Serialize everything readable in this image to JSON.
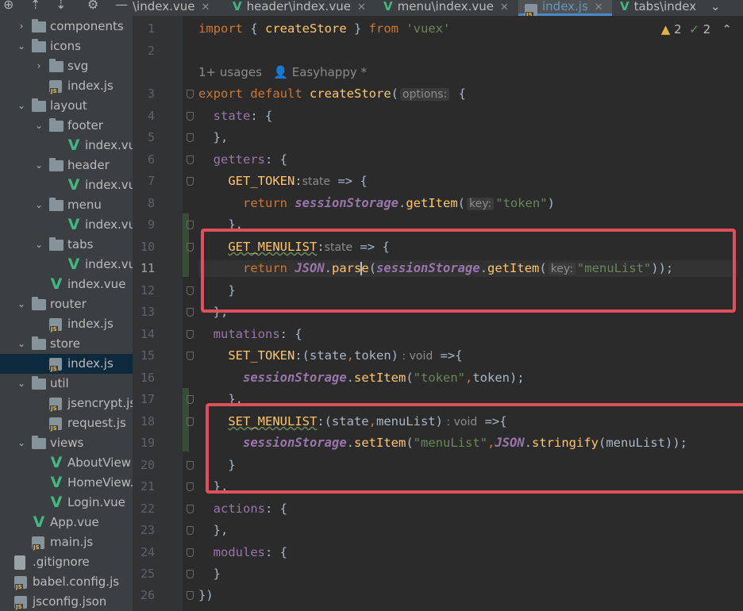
{
  "sidebar": {
    "items": [
      {
        "label": "components",
        "type": "folder",
        "open": false
      },
      {
        "label": "icons",
        "type": "folder",
        "open": true
      },
      {
        "label": "svg",
        "type": "folder",
        "open": false
      },
      {
        "label": "index.js",
        "type": "js"
      },
      {
        "label": "layout",
        "type": "folder",
        "open": true
      },
      {
        "label": "footer",
        "type": "folder",
        "open": true
      },
      {
        "label": "index.vu",
        "type": "vue"
      },
      {
        "label": "header",
        "type": "folder",
        "open": true
      },
      {
        "label": "index.vu",
        "type": "vue"
      },
      {
        "label": "menu",
        "type": "folder",
        "open": true
      },
      {
        "label": "index.vu",
        "type": "vue"
      },
      {
        "label": "tabs",
        "type": "folder",
        "open": true
      },
      {
        "label": "index.vu",
        "type": "vue"
      },
      {
        "label": "index.vue",
        "type": "vue"
      },
      {
        "label": "router",
        "type": "folder",
        "open": true
      },
      {
        "label": "index.js",
        "type": "js"
      },
      {
        "label": "store",
        "type": "folder",
        "open": true
      },
      {
        "label": "index.js",
        "type": "js",
        "selected": true
      },
      {
        "label": "util",
        "type": "folder",
        "open": true
      },
      {
        "label": "jsencrypt.js",
        "type": "js"
      },
      {
        "label": "request.js",
        "type": "js"
      },
      {
        "label": "views",
        "type": "folder",
        "open": true
      },
      {
        "label": "AboutView",
        "type": "vue"
      },
      {
        "label": "HomeView.",
        "type": "vue"
      },
      {
        "label": "Login.vue",
        "type": "vue"
      },
      {
        "label": "App.vue",
        "type": "vue"
      },
      {
        "label": "main.js",
        "type": "js"
      },
      {
        "label": ".gitignore",
        "type": "git"
      },
      {
        "label": "babel.config.js",
        "type": "js"
      },
      {
        "label": "jsconfig.json",
        "type": "json"
      }
    ]
  },
  "tabs": [
    {
      "label": "\\index.vue",
      "active": false
    },
    {
      "label": "header\\index.vue",
      "active": false
    },
    {
      "label": "menu\\index.vue",
      "active": false
    },
    {
      "label": "index.js",
      "active": true
    },
    {
      "label": "tabs\\index",
      "active": false
    }
  ],
  "status": {
    "warnings": "2",
    "typos": "2"
  },
  "meta": {
    "usages": "1+ usages",
    "author": "Easyhappy *"
  },
  "line_numbers": [
    "1",
    "2",
    "3",
    "4",
    "5",
    "6",
    "7",
    "8",
    "9",
    "10",
    "11",
    "12",
    "13",
    "14",
    "15",
    "16",
    "17",
    "18",
    "19",
    "20",
    "21",
    "22",
    "23",
    "24",
    "25",
    "26"
  ],
  "code": {
    "l1": {
      "kw_import": "import",
      "brace_open": " { ",
      "name": "createStore",
      "brace_close": " } ",
      "kw_from": "from",
      "sp": " ",
      "str": "'vuex'"
    },
    "l3": {
      "kw_export": "export",
      "kw_default": " default ",
      "fn": "createStore",
      "paren": "(",
      "hint": "options:",
      "tail": " {"
    },
    "l4": {
      "prop": "state",
      "tail": ": {"
    },
    "l5": {
      "text": "},"
    },
    "l6": {
      "prop": "getters",
      "tail": ": {"
    },
    "l7": {
      "fn": "GET_TOKEN",
      "colon": ":",
      "param": "state",
      "tail": " => {"
    },
    "l8": {
      "kw": "return",
      "glob": "sessionStorage",
      "dot": ".",
      "fn": "getItem",
      "paren": "(",
      "hint": "key:",
      "str": "\"token\"",
      "close": ")"
    },
    "l9": {
      "text": "},"
    },
    "l10": {
      "fn": "GET_MENULIST",
      "colon": ":",
      "param": "state",
      "tail": " => {"
    },
    "l11": {
      "kw": "return",
      "glob1": "JSON",
      "dot1": ".",
      "fn1a": "pars",
      "fn1b": "e",
      "paren1": "(",
      "glob2": "sessionStorage",
      "dot2": ".",
      "fn2": "getItem",
      "paren2": "(",
      "hint": "key:",
      "str": "\"menuList\"",
      "close": "));"
    },
    "l12": {
      "text": "}"
    },
    "l13": {
      "text": "},"
    },
    "l14": {
      "prop": "mutations",
      "tail": ": {"
    },
    "l15": {
      "fn": "SET_TOKEN",
      "open": ":(state",
      "comma": ",",
      "param2": "token)",
      "type": " : void",
      "tail": " =>{"
    },
    "l16": {
      "glob": "sessionStorage",
      "dot": ".",
      "fn": "setItem",
      "paren": "(",
      "str": "\"token\"",
      "comma": ",",
      "arg": "token",
      "close": ");"
    },
    "l17": {
      "text": "},"
    },
    "l18": {
      "fn": "SET_MENULIST",
      "open": ":(state",
      "comma": ",",
      "param2": "menuList)",
      "type": " : void",
      "tail": " =>{"
    },
    "l19": {
      "glob": "sessionStorage",
      "dot": ".",
      "fn": "setItem",
      "paren": "(",
      "str": "\"menuList\"",
      "comma": ",",
      "glob2": "JSON",
      "dot2": ".",
      "fn2": "stringify",
      "args": "(menuList));"
    },
    "l20": {
      "text": "}"
    },
    "l21": {
      "text": "},"
    },
    "l22": {
      "prop": "actions",
      "tail": ": {"
    },
    "l23": {
      "text": "},"
    },
    "l24": {
      "prop": "modules",
      "tail": ": {"
    },
    "l25": {
      "text": "}"
    },
    "l26": {
      "text": "})"
    }
  }
}
